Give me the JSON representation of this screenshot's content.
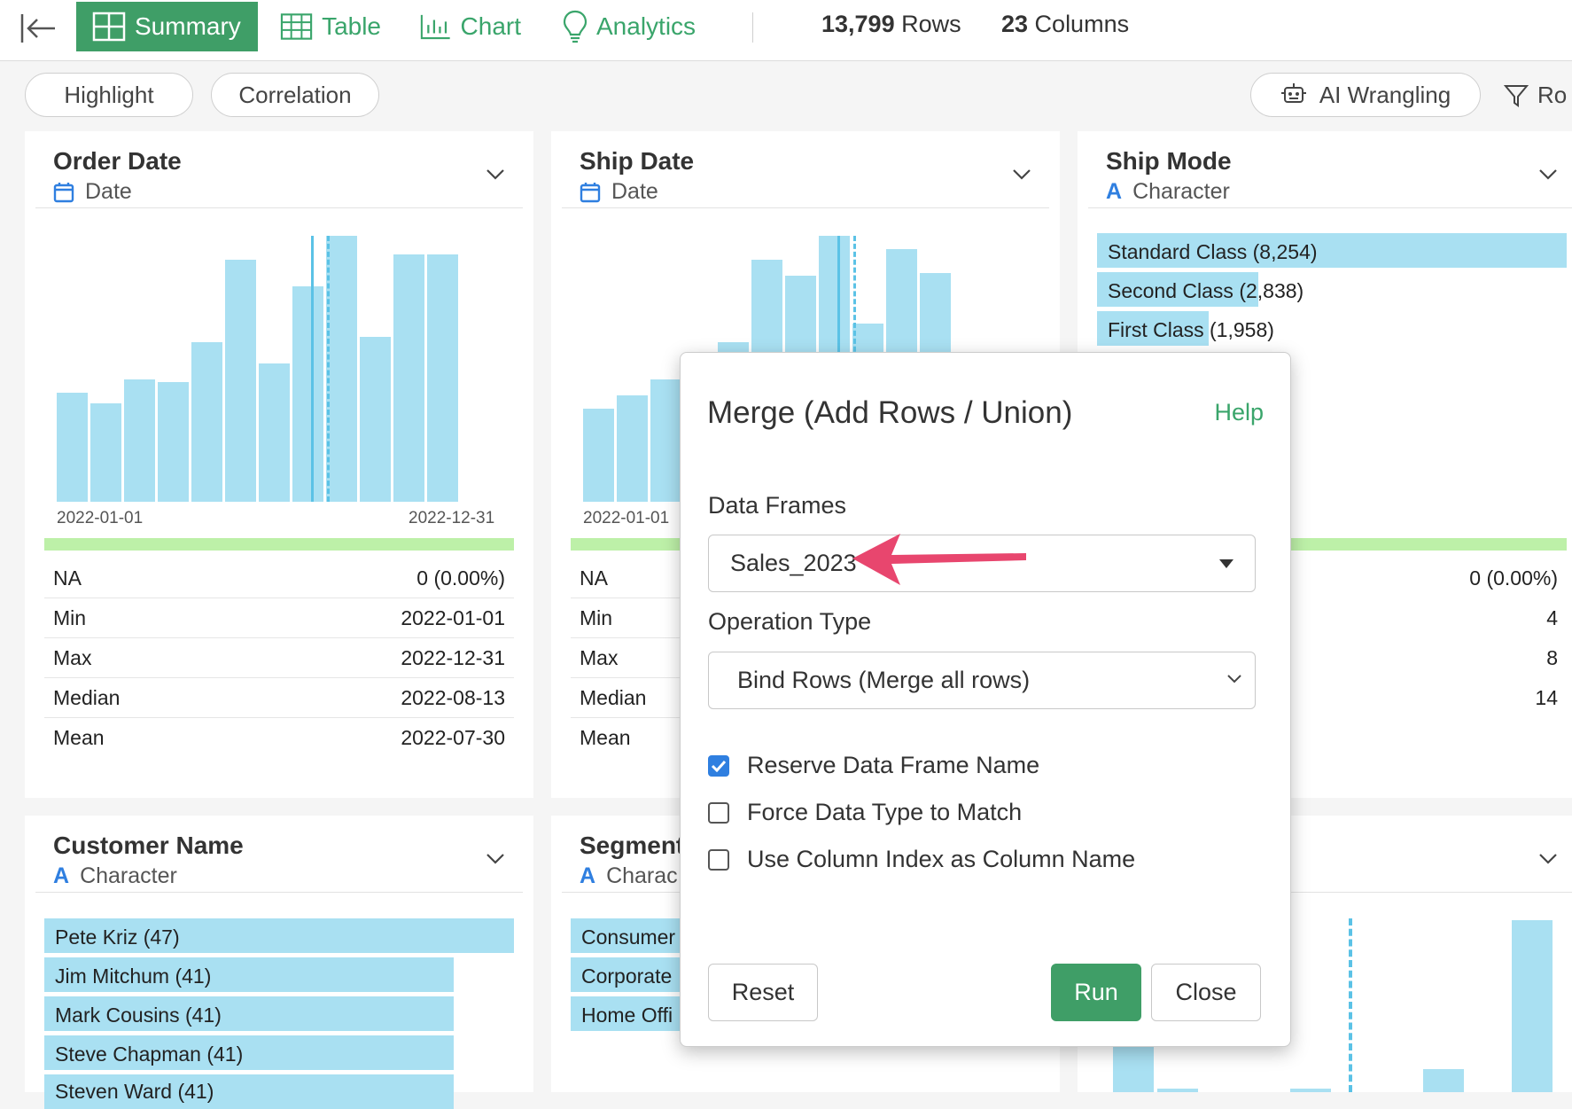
{
  "toolbar": {
    "tabs": [
      {
        "label": "Summary",
        "icon": "grid-icon",
        "active": true
      },
      {
        "label": "Table",
        "icon": "table-icon"
      },
      {
        "label": "Chart",
        "icon": "bar-chart-icon"
      },
      {
        "label": "Analytics",
        "icon": "lightbulb-icon"
      }
    ],
    "rows_count": "13,799",
    "rows_label": " Rows",
    "cols_count": "23",
    "cols_label": " Columns"
  },
  "subbar": {
    "highlight": "Highlight",
    "correlation": "Correlation",
    "ai_wrangling": "AI Wrangling",
    "rows_filter": "Ro"
  },
  "cards": {
    "order_date": {
      "title": "Order Date",
      "type": "Date",
      "x_start": "2022-01-01",
      "x_end": "2022-12-31",
      "stats": [
        {
          "label": "NA",
          "value": "0 (0.00%)"
        },
        {
          "label": "Min",
          "value": "2022-01-01"
        },
        {
          "label": "Max",
          "value": "2022-12-31"
        },
        {
          "label": "Median",
          "value": "2022-08-13"
        },
        {
          "label": "Mean",
          "value": "2022-07-30"
        }
      ]
    },
    "ship_date": {
      "title": "Ship Date",
      "type": "Date",
      "x_start": "2022-01-01",
      "stats": [
        {
          "label": "NA"
        },
        {
          "label": "Min"
        },
        {
          "label": "Max"
        },
        {
          "label": "Median"
        },
        {
          "label": "Mean"
        }
      ]
    },
    "ship_mode": {
      "title": "Ship Mode",
      "type": "Character",
      "items": [
        {
          "name": "Standard Class",
          "count": "(8,254)"
        },
        {
          "name": "Second Class",
          "count": "(2,838)"
        },
        {
          "name": "First Class",
          "count": "(1,958)"
        }
      ],
      "stat_values": [
        "0 (0.00%)",
        "4",
        "8",
        "14"
      ]
    },
    "customer_name": {
      "title": "Customer Name",
      "type": "Character",
      "items": [
        "Pete Kriz (47)",
        "Jim Mitchum (41)",
        "Mark Cousins (41)",
        "Steve Chapman (41)",
        "Steven Ward (41)"
      ]
    },
    "segment": {
      "title": "Segment",
      "type": "Charac",
      "items": [
        "Consumer",
        "Corporate",
        "Home Offi"
      ]
    }
  },
  "chart_data": [
    {
      "type": "bar",
      "chart": "Order Date histogram",
      "values": [
        0.41,
        0.37,
        0.46,
        0.45,
        0.6,
        0.91,
        0.52,
        0.81,
        1.0,
        0.62,
        0.93,
        0.93
      ],
      "x_start": "2022-01-01",
      "x_end": "2022-12-31"
    },
    {
      "type": "bar",
      "chart": "Ship Date histogram",
      "values": [
        0.35,
        0.4,
        0.46,
        0.5,
        0.6,
        0.91,
        0.85,
        1.0,
        0.67,
        0.95,
        0.86
      ]
    }
  ],
  "modal": {
    "title": "Merge (Add Rows / Union)",
    "help": "Help",
    "data_frames_label": "Data Frames",
    "data_frames_value": "Sales_2023",
    "operation_type_label": "Operation Type",
    "operation_type_value": "Bind Rows (Merge all rows)",
    "checkboxes": [
      {
        "label": "Reserve Data Frame Name",
        "checked": true
      },
      {
        "label": "Force Data Type to Match",
        "checked": false
      },
      {
        "label": "Use Column Index as Column Name",
        "checked": false
      }
    ],
    "reset": "Reset",
    "run": "Run",
    "close": "Close"
  },
  "colors": {
    "accent": "#3f9e67",
    "bar": "#a9e0f2",
    "arrow": "#e8466e",
    "check": "#2f7fe0"
  }
}
